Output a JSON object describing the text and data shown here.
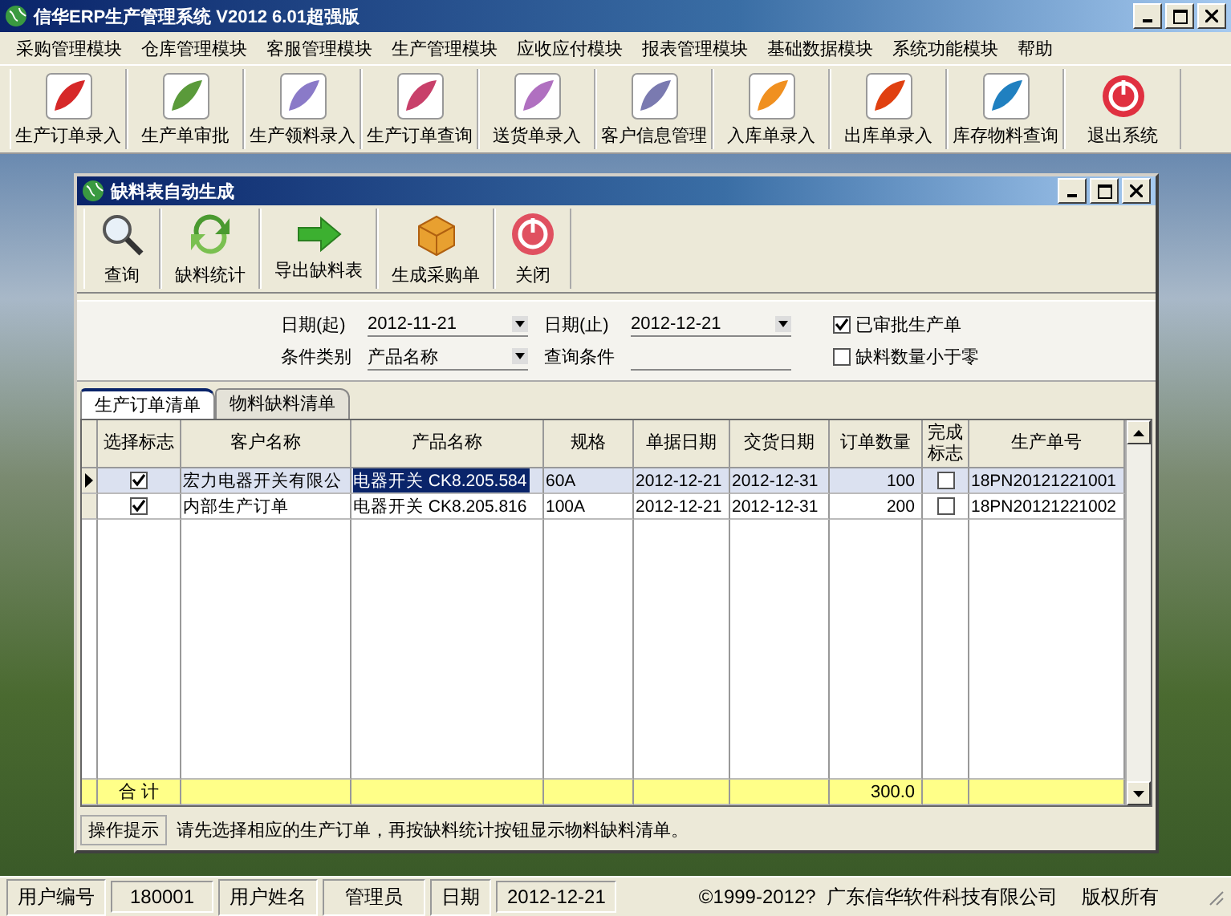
{
  "window": {
    "title": "信华ERP生产管理系统 V2012 6.01超强版"
  },
  "menu": [
    "采购管理模块",
    "仓库管理模块",
    "客服管理模块",
    "生产管理模块",
    "应收应付模块",
    "报表管理模块",
    "基础数据模块",
    "系统功能模块",
    "帮助"
  ],
  "toolbar": [
    {
      "label": "生产订单录入",
      "kind": "launch",
      "color": "#d62828"
    },
    {
      "label": "生产单审批",
      "kind": "launch",
      "color": "#5a9a3a"
    },
    {
      "label": "生产领料录入",
      "kind": "launch",
      "color": "#8a7ac8"
    },
    {
      "label": "生产订单查询",
      "kind": "launch",
      "color": "#c8406a"
    },
    {
      "label": "送货单录入",
      "kind": "launch",
      "color": "#b070c0"
    },
    {
      "label": "客户信息管理",
      "kind": "launch",
      "color": "#7a7ab0"
    },
    {
      "label": "入库单录入",
      "kind": "launch",
      "color": "#f09020"
    },
    {
      "label": "出库单录入",
      "kind": "launch",
      "color": "#e04010"
    },
    {
      "label": "库存物料查询",
      "kind": "launch",
      "color": "#2080c0"
    },
    {
      "label": "退出系统",
      "kind": "exit",
      "color": "#e03040"
    }
  ],
  "child_window": {
    "title": "缺料表自动生成",
    "toolbar": [
      {
        "label": "查询",
        "kind": "search"
      },
      {
        "label": "缺料统计",
        "kind": "refresh"
      },
      {
        "label": "导出缺料表",
        "kind": "export"
      },
      {
        "label": "生成采购单",
        "kind": "package"
      },
      {
        "label": "关闭",
        "kind": "exit"
      }
    ],
    "filters": {
      "date_from": {
        "label": "日期(起)",
        "value": "2012-11-21"
      },
      "date_to": {
        "label": "日期(止)",
        "value": "2012-12-21"
      },
      "condition_type": {
        "label": "条件类别",
        "value": "产品名称"
      },
      "query": {
        "label": "查询条件"
      },
      "checkboxes": [
        {
          "label": "已审批生产单",
          "checked": true
        },
        {
          "label": "缺料数量小于零",
          "checked": false
        }
      ]
    },
    "tabs": [
      {
        "label": "生产订单清单",
        "selected": true
      },
      {
        "label": "物料缺料清单",
        "selected": false
      }
    ],
    "table": {
      "columns": [
        {
          "label": "选择标志",
          "kind": "check"
        },
        {
          "label": "客户名称",
          "kind": "text"
        },
        {
          "label": "产品名称",
          "kind": "text"
        },
        {
          "label": "规格",
          "kind": "text"
        },
        {
          "label": "单据日期",
          "kind": "text"
        },
        {
          "label": "交货日期",
          "kind": "text"
        },
        {
          "label": "订单数量",
          "kind": "number"
        },
        {
          "label": "完成标志",
          "kind": "check"
        },
        {
          "label": "生产单号",
          "kind": "text"
        }
      ],
      "rows": [
        {
          "selected": true,
          "cells": [
            {
              "checked": true
            },
            {
              "text": "宏力电器开关有限公"
            },
            {
              "text": "电器开关 CK8.205.584",
              "focused": true
            },
            {
              "text": "60A"
            },
            {
              "text": "2012-12-21"
            },
            {
              "text": "2012-12-31"
            },
            {
              "text": "100"
            },
            {
              "checked": false
            },
            {
              "text": "18PN20121221001"
            }
          ]
        },
        {
          "selected": false,
          "cells": [
            {
              "checked": true
            },
            {
              "text": "内部生产订单"
            },
            {
              "text": "电器开关 CK8.205.816",
              "focused": false
            },
            {
              "text": "100A"
            },
            {
              "text": "2012-12-21"
            },
            {
              "text": "2012-12-31"
            },
            {
              "text": "200"
            },
            {
              "checked": false
            },
            {
              "text": "18PN20121221002"
            }
          ]
        }
      ],
      "totals": {
        "label": "合 计",
        "quantity": "300.0"
      }
    },
    "hint": {
      "label": "操作提示",
      "text": "请先选择相应的生产订单，再按缺料统计按钮显示物料缺料清单。"
    }
  },
  "status_bar": [
    {
      "text": "用户编号",
      "kind": "label"
    },
    {
      "text": "180001",
      "kind": "value"
    },
    {
      "text": "用户姓名",
      "kind": "label"
    },
    {
      "text": "管理员",
      "kind": "value"
    },
    {
      "text": "日期",
      "kind": "label"
    },
    {
      "text": "2012-12-21",
      "kind": "value"
    },
    {
      "text": "©1999-2012?  广东信华软件科技有限公司",
      "kind": "info"
    },
    {
      "text": "版权所有",
      "kind": "info"
    }
  ]
}
